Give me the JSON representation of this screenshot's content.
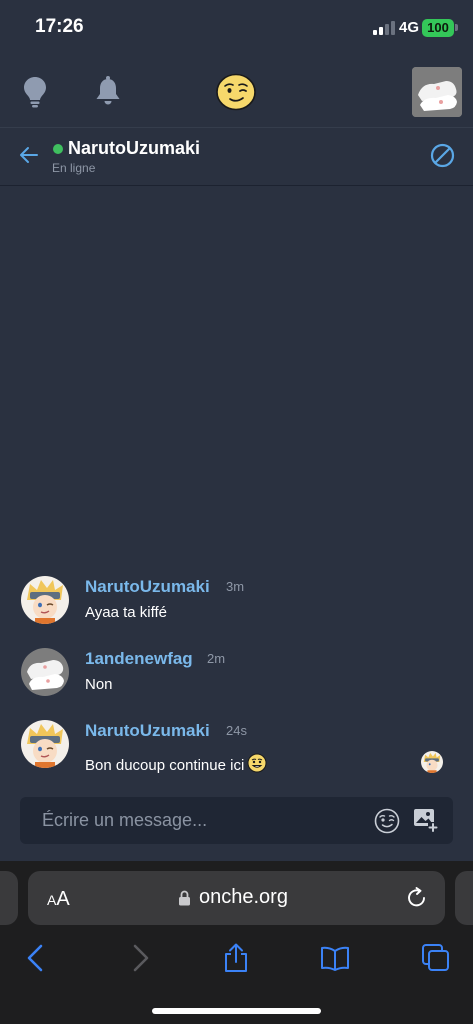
{
  "status_bar": {
    "time": "17:26",
    "network": "4G",
    "battery": "100"
  },
  "top_nav": {
    "icons": [
      "lightbulb-icon",
      "bell-icon",
      "smiley-logo-icon",
      "profile-avatar"
    ]
  },
  "chat_header": {
    "name": "NarutoUzumaki",
    "status": "En ligne"
  },
  "messages": [
    {
      "author": "NarutoUzumaki",
      "time": "3m",
      "text": "Ayaa ta kiffé"
    },
    {
      "author": "1andenewfag",
      "time": "2m",
      "text": "Non"
    },
    {
      "author": "NarutoUzumaki",
      "time": "24s",
      "text": "Bon ducoup continue ici"
    }
  ],
  "composer": {
    "placeholder": "Écrire un message..."
  },
  "browser": {
    "aa_label_small": "A",
    "aa_label_large": "A",
    "url": "onche.org"
  },
  "colors": {
    "background": "#2a3140",
    "author": "#7ab8ea",
    "accent": "#5aa7e6",
    "online": "#3fbf5f",
    "battery": "#34c759"
  }
}
